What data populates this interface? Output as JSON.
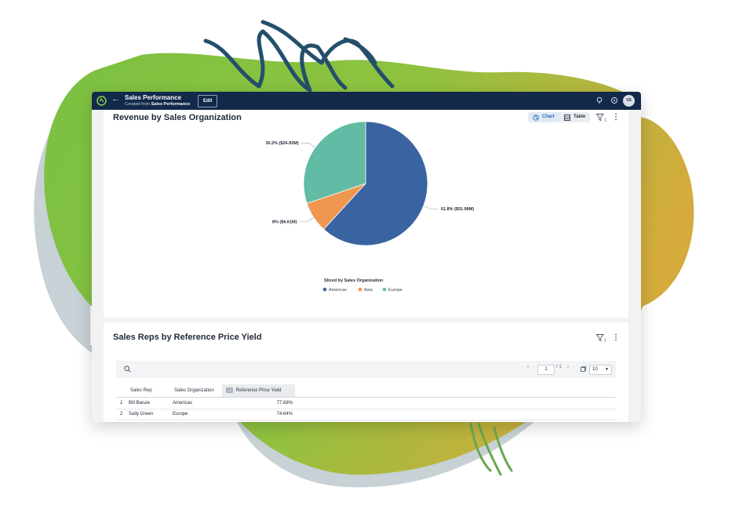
{
  "app": {
    "title": "Sales Performance",
    "subtitle_prefix": "Created from",
    "subtitle_source": "Sales Performance",
    "edit_label": "Edit",
    "avatar_initials": "VS"
  },
  "colors": {
    "topbar": "#12294a",
    "americas": "#3a64a1",
    "asia": "#ef9650",
    "europe": "#62bba4",
    "blob_green": "#7bc142",
    "blob_gold": "#d4ab3c",
    "scribble": "#244f6b"
  },
  "revenue_card": {
    "title": "Revenue by Sales Organization",
    "chart_toggle_label": "Chart",
    "table_toggle_label": "Table",
    "filter_count": "1"
  },
  "chart_data": {
    "type": "pie",
    "title": "",
    "legend_title": "Sliced by Sales Organization",
    "legend_placement": "bottom",
    "slices": [
      {
        "name": "Americas",
        "percent": 61.8,
        "value_label": "$51.08M",
        "label": "61.8% ($51.08M)"
      },
      {
        "name": "Asia",
        "percent": 8,
        "value_label": "$6.61M",
        "label": "8% ($6.61M)"
      },
      {
        "name": "Europe",
        "percent": 30.2,
        "value_label": "$24.93M",
        "label": "30.2% ($24.93M)"
      }
    ]
  },
  "reps_card": {
    "title": "Sales Reps by Reference Price Yield",
    "filter_count": "1",
    "pager": {
      "prev": "‹",
      "current_page": "1",
      "total": "/ 1",
      "next": "›",
      "page_size": "10"
    },
    "columns": [
      "Sales Rep",
      "Sales Organization",
      "Reference Price Yield"
    ],
    "sort_badge": "↓1",
    "rows": [
      {
        "index": "1",
        "rep": "Bill Baruie",
        "org": "Americas",
        "yield": "77.68%"
      },
      {
        "index": "2",
        "rep": "Sally Green",
        "org": "Europe",
        "yield": "74.64%"
      }
    ]
  }
}
